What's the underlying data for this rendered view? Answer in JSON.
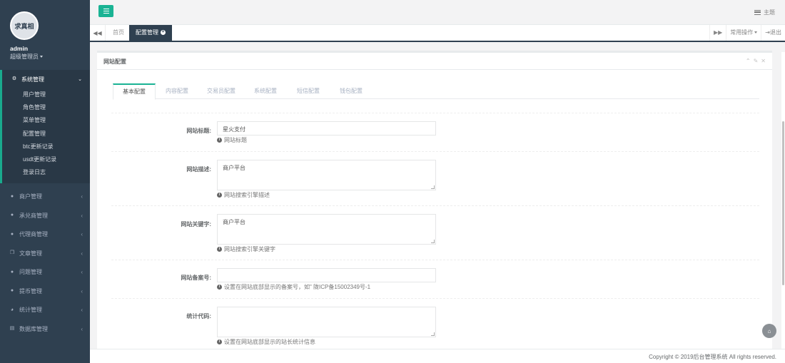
{
  "sidebar": {
    "avatar_text": "求真相",
    "user_name": "admin",
    "user_role": "超级管理员",
    "active_group": {
      "label": "系统管理",
      "icon": "gear-icon",
      "children": [
        "用户管理",
        "角色管理",
        "菜单管理",
        "配置管理",
        "btc更新记录",
        "usdt更新记录",
        "登录日志"
      ]
    },
    "groups": [
      {
        "label": "商户管理",
        "icon": "user-icon"
      },
      {
        "label": "承兑商管理",
        "icon": "user-icon"
      },
      {
        "label": "代理商管理",
        "icon": "user-icon"
      },
      {
        "label": "文章管理",
        "icon": "copy-icon"
      },
      {
        "label": "问题管理",
        "icon": "comment-icon"
      },
      {
        "label": "提币管理",
        "icon": "user-icon"
      },
      {
        "label": "统计管理",
        "icon": "pie-chart-icon"
      },
      {
        "label": "数据库管理",
        "icon": "database-icon"
      }
    ]
  },
  "topbar": {
    "theme_label": "主题"
  },
  "tabs": {
    "items": [
      {
        "label": "首页",
        "active": false
      },
      {
        "label": "配置管理",
        "active": true
      }
    ],
    "common_ops": "常用操作",
    "logout": "退出"
  },
  "panel": {
    "title": "网站配置",
    "subtabs": [
      "基本配置",
      "内容配置",
      "交易员配置",
      "系统配置",
      "短信配置",
      "钱包配置"
    ],
    "fields": [
      {
        "label": "网站标题:",
        "value": "星火支付",
        "placeholder": "",
        "help": "网站标题",
        "type": "input"
      },
      {
        "label": "网站描述:",
        "value": "商户平台",
        "placeholder": "",
        "help": "网站搜索引擎描述",
        "type": "textarea"
      },
      {
        "label": "网站关键字:",
        "value": "商户平台",
        "placeholder": "",
        "help": "网站搜索引擎关键字",
        "type": "textarea"
      },
      {
        "label": "网站备案号:",
        "value": "",
        "placeholder": "",
        "help": "设置在网站底部显示的备案号，如\" 陇ICP备15002349号-1",
        "type": "input"
      },
      {
        "label": "统计代码:",
        "value": "",
        "placeholder": "",
        "help": "设置在网站底部显示的站长统计信息",
        "type": "textarea"
      }
    ]
  },
  "footer": {
    "text": "Copyright © 2019后台管理系统 All rights reserved."
  },
  "colors": {
    "sidebar_bg": "#2f4050",
    "accent": "#1ab394"
  }
}
